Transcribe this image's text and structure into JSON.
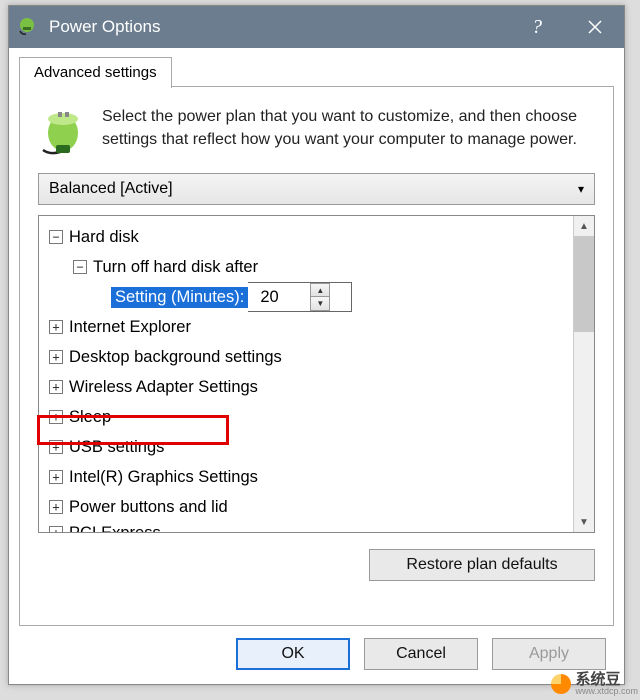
{
  "title": "Power Options",
  "tab": "Advanced settings",
  "intro": "Select the power plan that you want to customize, and then choose settings that reflect how you want your computer to manage power.",
  "plan": "Balanced [Active]",
  "tree": {
    "hard_disk": "Hard disk",
    "turn_off": "Turn off hard disk after",
    "setting_label": "Setting (Minutes):",
    "setting_value": "20",
    "ie": "Internet Explorer",
    "desktop_bg": "Desktop background settings",
    "wireless": "Wireless Adapter Settings",
    "sleep": "Sleep",
    "usb": "USB settings",
    "intel_gfx": "Intel(R) Graphics Settings",
    "power_buttons": "Power buttons and lid",
    "pci": "PCI Express"
  },
  "restore": "Restore plan defaults",
  "buttons": {
    "ok": "OK",
    "cancel": "Cancel",
    "apply": "Apply"
  },
  "watermark": "系统豆",
  "watermark_url": "www.xtdcp.com"
}
